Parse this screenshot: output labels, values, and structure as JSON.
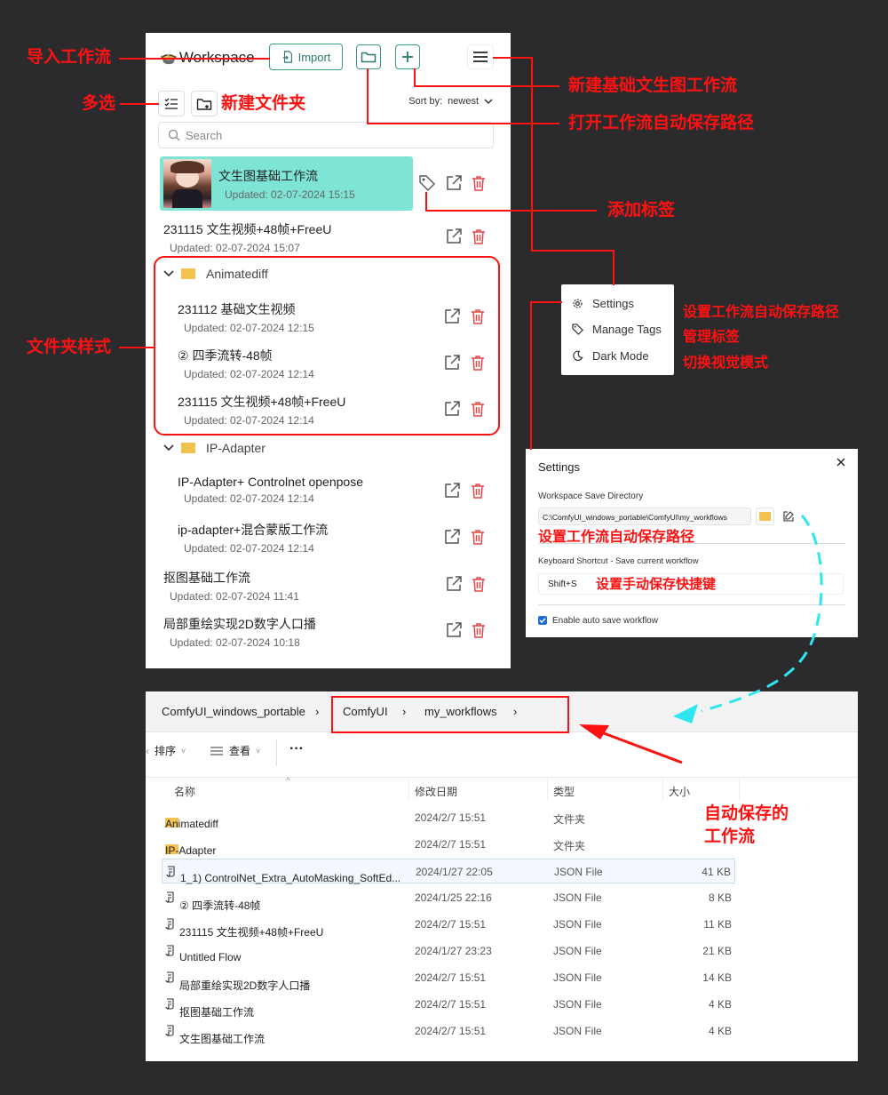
{
  "annotations": {
    "import_wf": "导入工作流",
    "multi_select": "多选",
    "new_folder": "新建文件夹",
    "new_basic_t2i": "新建基础文生图工作流",
    "open_autosave_path": "打开工作流自动保存路径",
    "add_tag": "添加标签",
    "folder_style": "文件夹样式",
    "menu_settings_note": "设置工作流自动保存路径",
    "menu_tags_note": "管理标签",
    "menu_dark_note": "切换视觉模式",
    "settings_dir_note": "设置工作流自动保存路径",
    "settings_shortcut_note": "设置手动保存快捷键",
    "explorer_note_1": "自动保存的",
    "explorer_note_2": "工作流"
  },
  "workspace": {
    "title": "Workspace",
    "import_label": "Import",
    "sort_label": "Sort by:",
    "sort_value": "newest",
    "search_placeholder": "Search",
    "items": [
      {
        "name": "文生图基础工作流",
        "updated": "Updated: 02-07-2024 15:15"
      },
      {
        "name": "231115 文生视频+48帧+FreeU",
        "updated": "Updated: 02-07-2024 15:07"
      }
    ],
    "folders": [
      {
        "name": "Animatediff",
        "items": [
          {
            "name": "231112 基础文生视频",
            "updated": "Updated: 02-07-2024 12:15"
          },
          {
            "name": "② 四季流转-48帧",
            "updated": "Updated: 02-07-2024 12:14"
          },
          {
            "name": "231115 文生视频+48帧+FreeU",
            "updated": "Updated: 02-07-2024 12:14"
          }
        ]
      },
      {
        "name": "IP-Adapter",
        "items": [
          {
            "name": "IP-Adapter+ Controlnet openpose",
            "updated": "Updated: 02-07-2024 12:14"
          },
          {
            "name": "ip-adapter+混合蒙版工作流",
            "updated": "Updated: 02-07-2024 12:14"
          }
        ]
      }
    ],
    "bottom_items": [
      {
        "name": "抠图基础工作流",
        "updated": "Updated: 02-07-2024 11:41"
      },
      {
        "name": "局部重绘实现2D数字人口播",
        "updated": "Updated: 02-07-2024 10:18"
      }
    ]
  },
  "menu": {
    "settings": "Settings",
    "manage_tags": "Manage Tags",
    "dark_mode": "Dark Mode"
  },
  "settings": {
    "title": "Settings",
    "dir_label": "Workspace Save Directory",
    "dir_value": "C:\\ComfyUI_windows_portable\\ComfyUI\\my_workflows",
    "shortcut_label": "Keyboard Shortcut - Save current workflow",
    "shortcut_value": "Shift+S",
    "autosave_label": "Enable auto save workflow"
  },
  "explorer": {
    "crumbs": [
      "ComfyUI_windows_portable",
      "ComfyUI",
      "my_workflows"
    ],
    "sort_btn": "排序",
    "view_btn": "查看",
    "more": "···",
    "col_name": "名称",
    "col_date": "修改日期",
    "col_type": "类型",
    "col_size": "大小",
    "rows": [
      {
        "name": "Animatediff",
        "date": "2024/2/7 15:51",
        "type": "文件夹",
        "size": "",
        "kind": "folder"
      },
      {
        "name": "IP-Adapter",
        "date": "2024/2/7 15:51",
        "type": "文件夹",
        "size": "",
        "kind": "folder"
      },
      {
        "name": "1_1) ControlNet_Extra_AutoMasking_SoftEd...",
        "date": "2024/1/27 22:05",
        "type": "JSON File",
        "size": "41 KB",
        "kind": "json"
      },
      {
        "name": "② 四季流转-48帧",
        "date": "2024/1/25 22:16",
        "type": "JSON File",
        "size": "8 KB",
        "kind": "json"
      },
      {
        "name": "231115 文生视频+48帧+FreeU",
        "date": "2024/2/7 15:51",
        "type": "JSON File",
        "size": "11 KB",
        "kind": "json"
      },
      {
        "name": "Untitled Flow",
        "date": "2024/1/27 23:23",
        "type": "JSON File",
        "size": "21 KB",
        "kind": "json"
      },
      {
        "name": "局部重绘实现2D数字人口播",
        "date": "2024/2/7 15:51",
        "type": "JSON File",
        "size": "14 KB",
        "kind": "json"
      },
      {
        "name": "抠图基础工作流",
        "date": "2024/2/7 15:51",
        "type": "JSON File",
        "size": "4 KB",
        "kind": "json"
      },
      {
        "name": "文生图基础工作流",
        "date": "2024/2/7 15:51",
        "type": "JSON File",
        "size": "4 KB",
        "kind": "json"
      }
    ]
  },
  "colors": {
    "annotation": "#ff1111",
    "accent": "#3a9a8a",
    "selected_bg": "#7ee5d6",
    "trash": "#e4474a",
    "cyan_arrow": "#2ee6f0"
  }
}
